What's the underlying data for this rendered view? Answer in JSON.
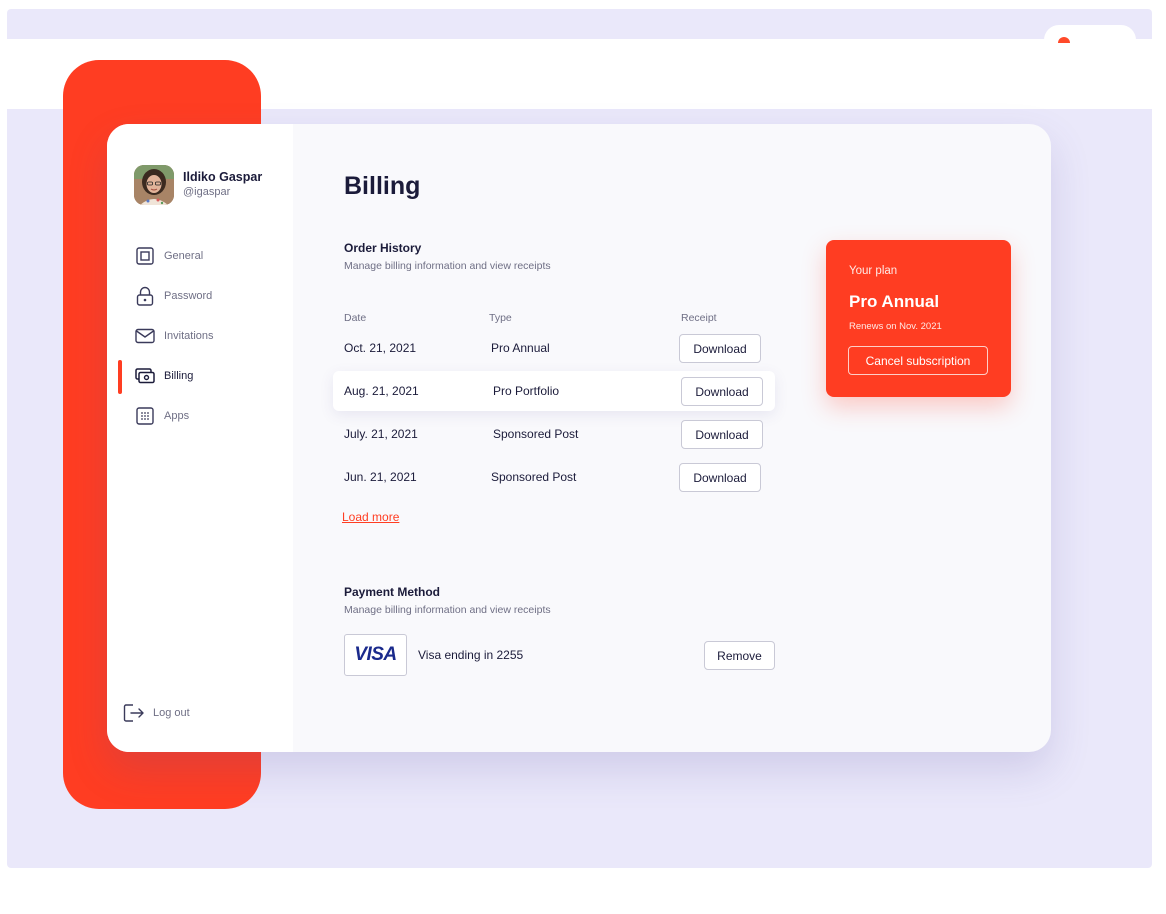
{
  "user": {
    "name": "Ildiko Gaspar",
    "handle": "@igaspar"
  },
  "sidebar": {
    "items": [
      {
        "label": "General",
        "icon": "square-icon",
        "active": false
      },
      {
        "label": "Password",
        "icon": "lock-icon",
        "active": false
      },
      {
        "label": "Invitations",
        "icon": "mail-icon",
        "active": false
      },
      {
        "label": "Billing",
        "icon": "cash-icon",
        "active": true
      },
      {
        "label": "Apps",
        "icon": "grid-icon",
        "active": false
      }
    ],
    "logout_label": "Log out"
  },
  "main": {
    "title": "Billing",
    "order_history": {
      "title": "Order History",
      "subtitle": "Manage billing information and view receipts",
      "columns": [
        "Date",
        "Type",
        "Receipt"
      ],
      "rows": [
        {
          "date": "Oct. 21, 2021",
          "type": "Pro Annual",
          "receipt": "Download"
        },
        {
          "date": "Aug. 21, 2021",
          "type": "Pro Portfolio",
          "receipt": "Download"
        },
        {
          "date": "July. 21, 2021",
          "type": "Sponsored Post",
          "receipt": "Download"
        },
        {
          "date": "Jun. 21, 2021",
          "type": "Sponsored Post",
          "receipt": "Download"
        }
      ],
      "load_more": "Load more"
    },
    "payment_method": {
      "title": "Payment Method",
      "subtitle": "Manage billing information and view receipts",
      "card_brand": "VISA",
      "card_label": "Visa ending in 2255",
      "remove_label": "Remove"
    }
  },
  "plan": {
    "label": "Your plan",
    "name": "Pro Annual",
    "renews": "Renews on  Nov. 2021",
    "cancel_label": "Cancel subscription"
  },
  "colors": {
    "accent": "#ff3d22",
    "background": "#eae8fa",
    "text": "#1b1b3a",
    "muted": "#6f6f85",
    "visa": "#1a2a8c"
  }
}
